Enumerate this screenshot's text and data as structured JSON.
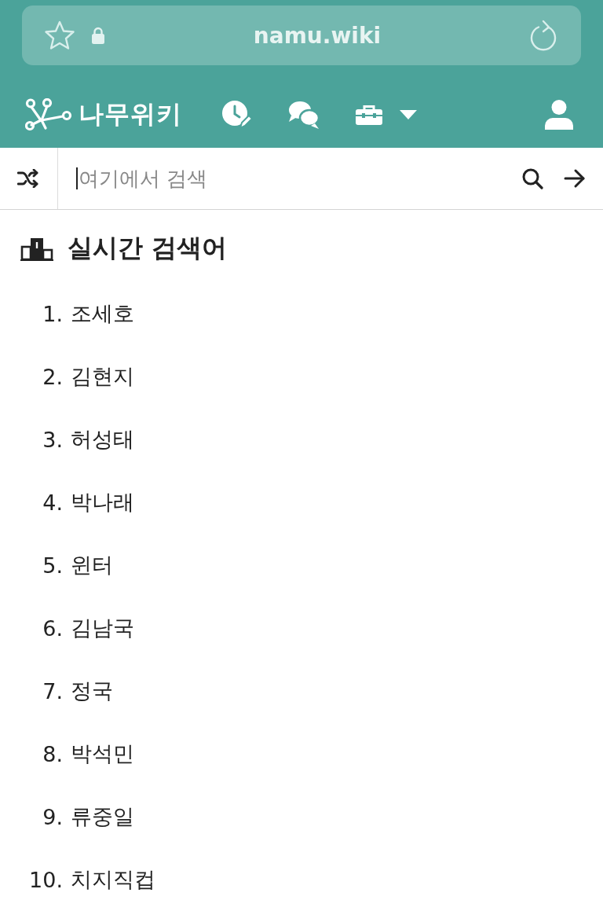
{
  "browser": {
    "url": "namu.wiki"
  },
  "nav": {
    "logo_text": "나무위키"
  },
  "search": {
    "placeholder": "여기에서 검색",
    "focused": true
  },
  "section": {
    "title": "실시간 검색어"
  },
  "trending": [
    {
      "rank": "1.",
      "term": "조세호"
    },
    {
      "rank": "2.",
      "term": "김현지"
    },
    {
      "rank": "3.",
      "term": "허성태"
    },
    {
      "rank": "4.",
      "term": "박나래"
    },
    {
      "rank": "5.",
      "term": "윈터"
    },
    {
      "rank": "6.",
      "term": "김남국"
    },
    {
      "rank": "7.",
      "term": "정국"
    },
    {
      "rank": "8.",
      "term": "박석민"
    },
    {
      "rank": "9.",
      "term": "류중일"
    },
    {
      "rank": "10.",
      "term": "치지직컵"
    }
  ]
}
